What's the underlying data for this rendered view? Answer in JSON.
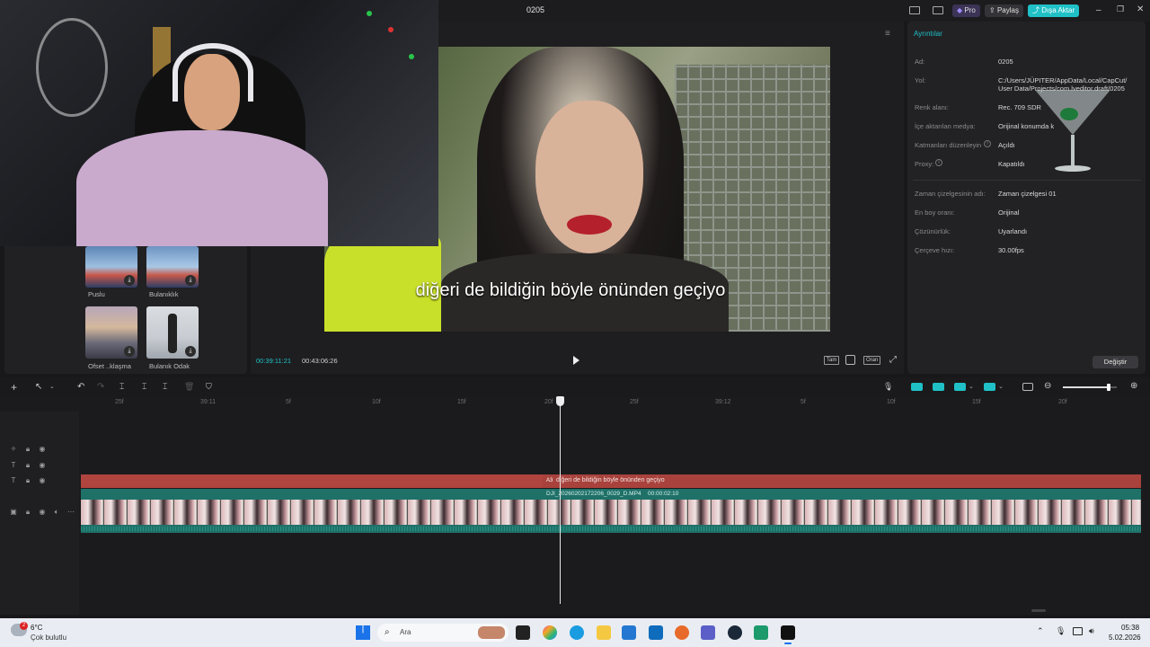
{
  "window": {
    "title": "0205",
    "buttons": {
      "pro": "Pro",
      "share": "Paylaş",
      "export": "Dışa Aktar"
    }
  },
  "media": {
    "items": [
      {
        "label": "Puslu"
      },
      {
        "label": "Bulanıklık"
      },
      {
        "label": "Ofset ..klaşma"
      },
      {
        "label": "Bulanık Odak"
      }
    ]
  },
  "player": {
    "subtitle": "diğeri de bildiğin böyle önünden geçiyo",
    "current_time": "00:39:11:21",
    "total_time": "00:43:06:26",
    "buttons": {
      "full": "Tam",
      "ratio": "Oran"
    }
  },
  "details": {
    "header": "Ayrıntılar",
    "rows": [
      {
        "key": "Ad:",
        "value": "0205"
      },
      {
        "key": "Yol:",
        "value": "C:/Users/JÜPITER/AppData/Local/CapCut/",
        "value2": "User Data/Projects/com.lveditor.draft/0205"
      },
      {
        "key": "Renk alanı:",
        "value": "Rec. 709 SDR"
      },
      {
        "key": "İçe aktarılan medya:",
        "value": "Orijinal konumda k"
      },
      {
        "key": "Katmanları düzenleyin",
        "value": "Açıldı"
      },
      {
        "key": "Proxy:",
        "value": "Kapatıldı"
      },
      {
        "key": "Zaman çizelgesinin adı:",
        "value": "Zaman çizelgesi 01"
      },
      {
        "key": "En boy oranı:",
        "value": "Orijinal"
      },
      {
        "key": "Çözünürlük:",
        "value": "Uyarlandı"
      },
      {
        "key": "Çerçeve hızı:",
        "value": "30.00fps"
      }
    ],
    "change_button": "Değiştir"
  },
  "timeline": {
    "ruler": [
      "25f",
      "39:11",
      "5f",
      "10f",
      "15f",
      "20f",
      "25f",
      "39:12",
      "5f",
      "10f",
      "15f",
      "20f"
    ],
    "text_clip": "diğeri de bildiğin böyle önünden geçiyo",
    "video_clip_name": "DJI_20260202172206_0029_D.MP4",
    "video_clip_duration": "00:00:02:10",
    "zoom_percent": 85
  },
  "taskbar": {
    "weather_temp": "6°C",
    "weather_desc": "Çok bulutlu",
    "weather_badge": "2",
    "search_placeholder": "Ara",
    "clock_time": "05:38",
    "clock_date": "5.02.2026"
  },
  "colors": {
    "accent": "#1fc1c7",
    "text_clip": "#b0443e",
    "video_clip": "#1f7168",
    "pro_badge": "#4b3c8f"
  }
}
